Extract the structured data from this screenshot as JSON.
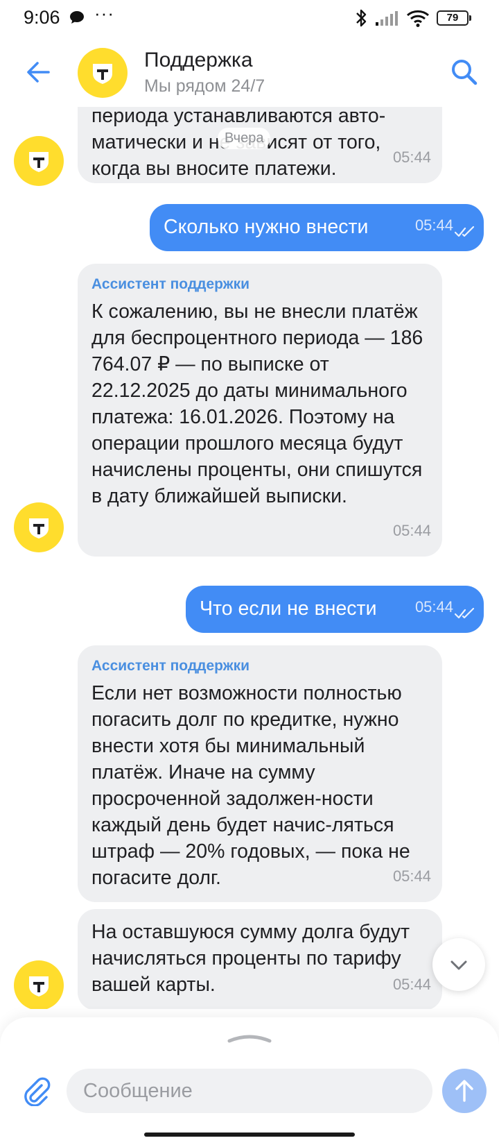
{
  "status": {
    "time": "9:06",
    "dots": "···",
    "battery": "79"
  },
  "header": {
    "title": "Поддержка",
    "subtitle": "Мы рядом 24/7",
    "avatar_letter": "Т"
  },
  "chat": {
    "date_chip": "Вчера",
    "messages": [
      {
        "direction": "in",
        "sender": "",
        "text": "периода устанавливаются авто-матически и не зависят от того, когда вы вносите платежи.",
        "time": "05:44"
      },
      {
        "direction": "out",
        "text": "Сколько нужно внести",
        "time": "05:44"
      },
      {
        "direction": "in",
        "sender": "Ассистент поддержки",
        "text": "К сожалению, вы не внесли платёж для беспроцентного периода — 186 764.07 ₽ — по выписке от 22.12.2025 до даты минимального платежа: 16.01.2026. Поэтому на операции прошлого месяца будут начислены проценты, они спишутся в дату ближайшей выписки.",
        "time": "05:44"
      },
      {
        "direction": "out",
        "text": "Что если не внести",
        "time": "05:44"
      },
      {
        "direction": "in",
        "sender": "Ассистент поддержки",
        "text": "Если нет возможности полностью погасить долг по кредитке, нужно внести хотя бы минимальный платёж. Иначе на сумму просроченной задолжен-ности каждый день будет начис-ляться штраф — 20% годовых, — пока не погасите долг.",
        "time": "05:44"
      },
      {
        "direction": "in",
        "sender": "",
        "text": "На оставшуюся сумму долга будут начисляться проценты по тарифу вашей карты.",
        "time": "05:44"
      }
    ]
  },
  "composer": {
    "placeholder": "Сообщение"
  },
  "colors": {
    "accent": "#428cf5",
    "brand_yellow": "#ffdd2d",
    "bubble_in": "#eeeff1"
  }
}
